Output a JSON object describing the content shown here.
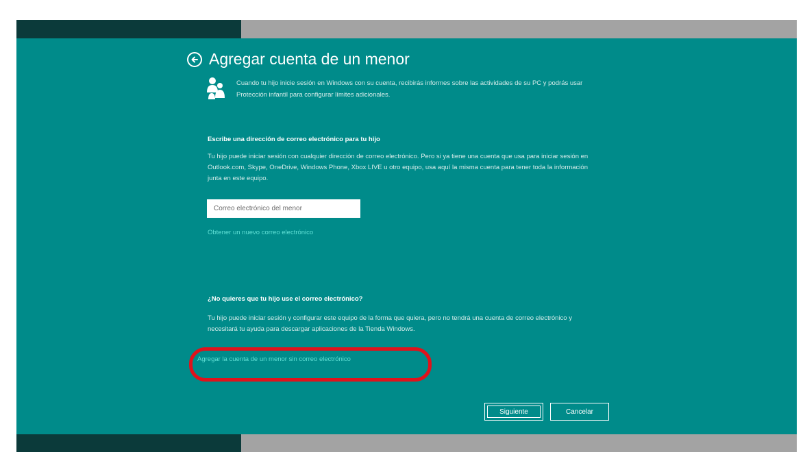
{
  "colors": {
    "panel": "#008b8a",
    "dark_bar": "#0b3a3a",
    "gray_bar": "#a3a3a3",
    "link": "#5fe0d6",
    "highlight": "#e0121b"
  },
  "header": {
    "back_icon": "arrow-left-circle-icon",
    "title": "Agregar cuenta de un menor",
    "family_icon": "family-icon",
    "intro": "Cuando tu hijo inicie sesión en Windows con su cuenta, recibirás informes sobre las actividades de su PC y podrás usar Protección infantil para configurar límites adicionales."
  },
  "email_section": {
    "heading": "Escribe una dirección de correo electrónico para tu hijo",
    "body": "Tu hijo puede iniciar sesión con cualquier dirección de correo electrónico. Pero si ya tiene una cuenta que usa para iniciar sesión en Outlook.com, Skype, OneDrive, Windows Phone, Xbox LIVE u otro equipo, usa aquí la misma cuenta para tener toda la información junta en este equipo.",
    "input_placeholder": "Correo electrónico del menor",
    "input_value": "",
    "new_email_link": "Obtener un nuevo correo electrónico"
  },
  "no_email_section": {
    "heading": "¿No quieres que tu hijo use el correo electrónico?",
    "body": "Tu hijo puede iniciar sesión y configurar este equipo de la forma que quiera, pero no tendrá una cuenta de correo electrónico y necesitará tu ayuda para descargar aplicaciones de la Tienda Windows.",
    "add_without_email_link": "Agregar la cuenta de un menor sin correo electrónico"
  },
  "buttons": {
    "next": "Siguiente",
    "cancel": "Cancelar"
  }
}
